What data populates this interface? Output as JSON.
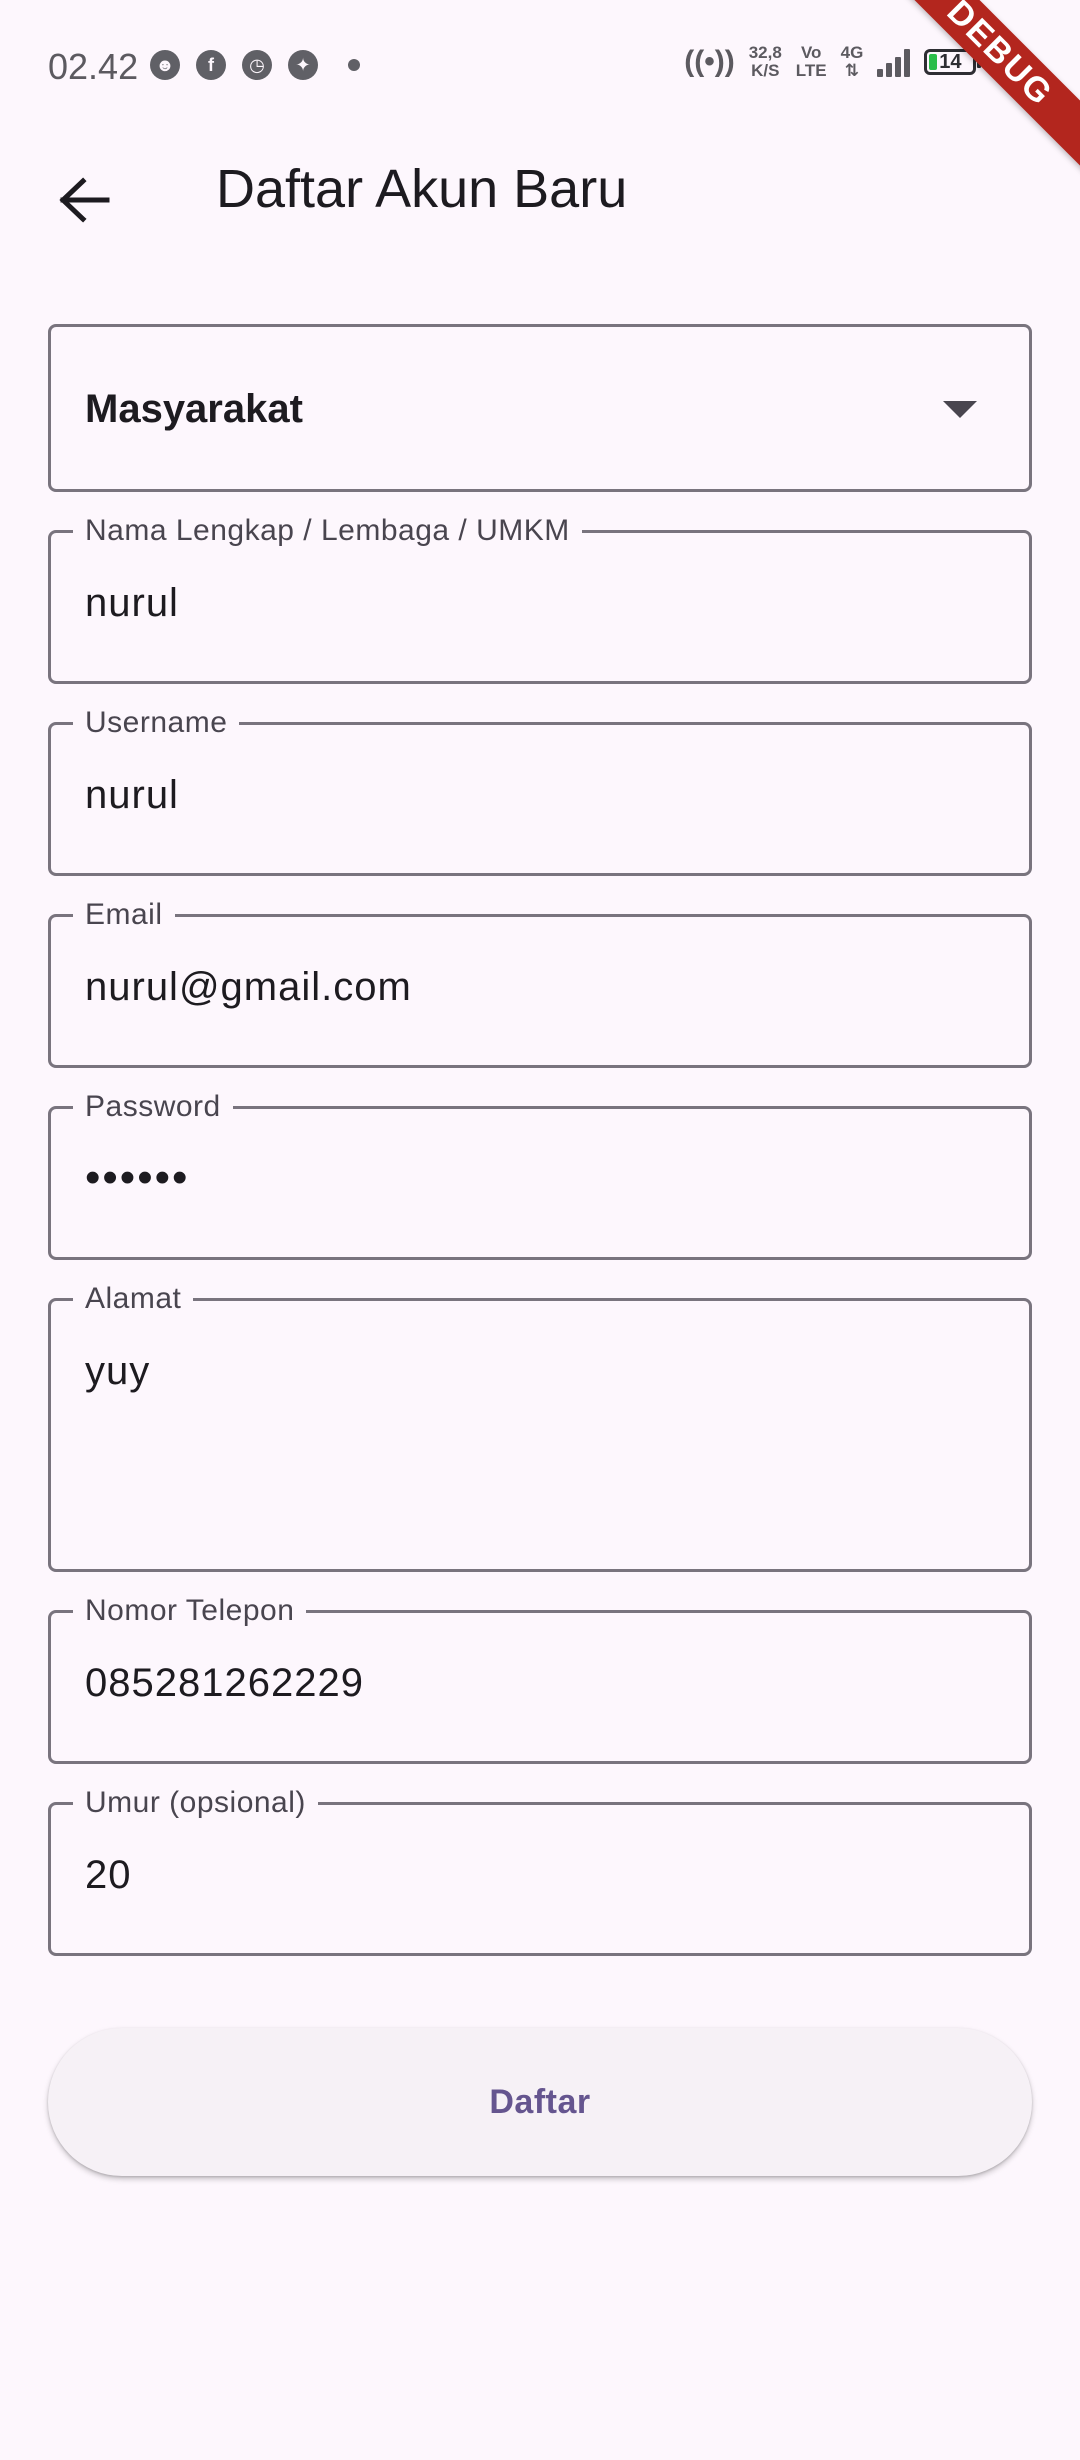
{
  "status_bar": {
    "time": "02.42",
    "hotspot_count": "2",
    "speed_value": "32,8",
    "speed_unit": "K/S",
    "volte_top": "Vo",
    "volte_bottom": "LTE",
    "network": "4G",
    "battery": "14"
  },
  "debug_banner": "DEBUG",
  "app_bar": {
    "title": "Daftar Akun Baru"
  },
  "form": {
    "role_dropdown": {
      "selected": "Masyarakat"
    },
    "fields": [
      {
        "label": "Nama Lengkap / Lembaga / UMKM",
        "value": "nurul"
      },
      {
        "label": "Username",
        "value": "nurul"
      },
      {
        "label": "Email",
        "value": "nurul@gmail.com"
      },
      {
        "label": "Password",
        "value": "••••••"
      },
      {
        "label": "Alamat",
        "value": "yuy"
      },
      {
        "label": "Nomor Telepon",
        "value": "085281262229"
      },
      {
        "label": "Umur (opsional)",
        "value": "20"
      }
    ],
    "submit_label": "Daftar"
  },
  "colors": {
    "background": "#fdf7fd",
    "outline": "#79747e",
    "primary": "#65558f",
    "debug": "#b3261e"
  }
}
